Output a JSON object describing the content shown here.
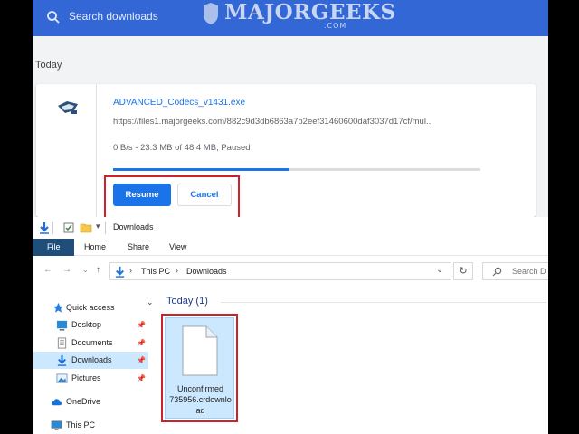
{
  "chrome": {
    "search_placeholder": "Search downloads",
    "watermark": "MAJORGEEKS",
    "watermark_sub": ".COM",
    "section_label": "Today",
    "download": {
      "file_name": "ADVANCED_Codecs_v1431.exe",
      "url": "https://files1.majorgeeks.com/882c9d3db6863a7b2eef31460600daf3037d17cf/mul...",
      "status": "0 B/s - 23.3 MB of 48.4 MB, Paused",
      "progress_fraction": 0.48,
      "resume_label": "Resume",
      "cancel_label": "Cancel"
    }
  },
  "explorer": {
    "title": "Downloads",
    "ribbon_tabs": [
      "File",
      "Home",
      "Share",
      "View"
    ],
    "address": {
      "parts": [
        "This PC",
        "Downloads"
      ]
    },
    "search_placeholder": "Search D",
    "nav_pane": [
      {
        "label": "Quick access",
        "icon": "star-icon",
        "pinned": false
      },
      {
        "label": "Desktop",
        "icon": "desktop-icon",
        "pinned": true
      },
      {
        "label": "Documents",
        "icon": "documents-icon",
        "pinned": true
      },
      {
        "label": "Downloads",
        "icon": "download-arrow-icon",
        "pinned": true,
        "selected": true
      },
      {
        "label": "Pictures",
        "icon": "pictures-icon",
        "pinned": true
      },
      {
        "label": "OneDrive",
        "icon": "cloud-icon",
        "pinned": false
      },
      {
        "label": "This PC",
        "icon": "computer-icon",
        "pinned": false
      }
    ],
    "group_title": "Today (1)",
    "file": {
      "label_lines": [
        "Unconfirmed",
        "735956.crdownlo",
        "ad"
      ]
    }
  },
  "colors": {
    "chrome_header": "#3367d6",
    "link_blue": "#1a73e8",
    "highlight_red": "#d0202a",
    "selection_blue": "#cce8ff",
    "ribbon_file": "#1e4e79"
  }
}
